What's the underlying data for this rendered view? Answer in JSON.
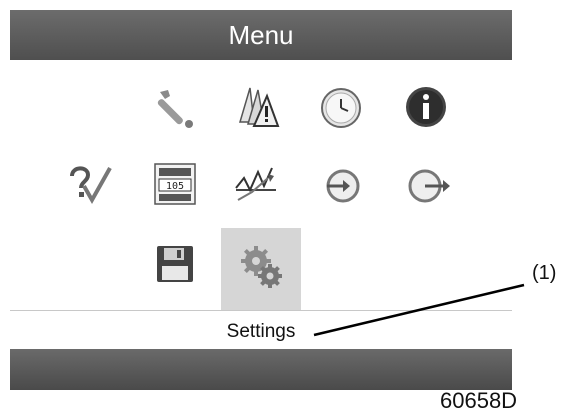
{
  "header": {
    "title": "Menu"
  },
  "menu": {
    "items": [
      {
        "icon": "wrench-icon"
      },
      {
        "icon": "warning-triangles-icon"
      },
      {
        "icon": "clock-icon"
      },
      {
        "icon": "info-icon"
      },
      {
        "icon": "help-check-icon"
      },
      {
        "icon": "counter-icon"
      },
      {
        "icon": "trend-graph-icon"
      },
      {
        "icon": "circle-arrow-in-icon"
      },
      {
        "icon": "circle-arrow-out-icon"
      },
      {
        "icon": "save-disk-icon"
      },
      {
        "icon": "settings-gears-icon",
        "selected": true
      }
    ]
  },
  "status": {
    "selected_label": "Settings"
  },
  "callout": {
    "label": "(1)"
  },
  "figure": {
    "id": "60658D"
  },
  "colors": {
    "header_bg": "#5a5a5a",
    "selected_bg": "#d6d6d6",
    "info_red": "#b02020"
  }
}
